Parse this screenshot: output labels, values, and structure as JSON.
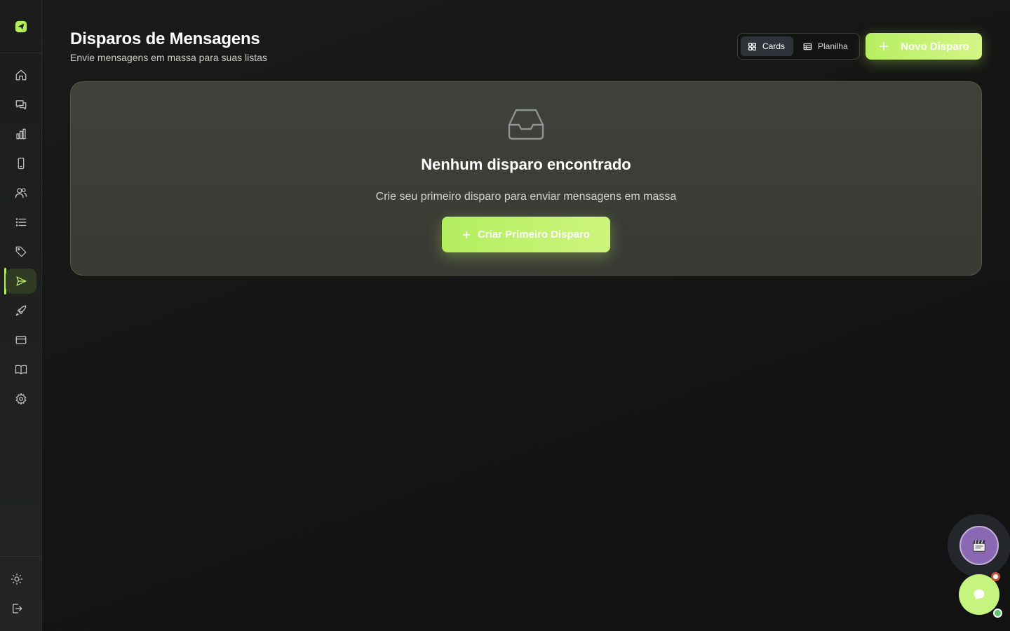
{
  "header": {
    "title": "Disparos de Mensagens",
    "subtitle": "Envie mensagens em massa para suas listas"
  },
  "view_toggle": {
    "cards_label": "Cards",
    "sheet_label": "Planilha",
    "selected": "Cards"
  },
  "actions": {
    "new_label": "Novo Disparo"
  },
  "empty_state": {
    "title": "Nenhum disparo encontrado",
    "description": "Crie seu primeiro disparo para enviar mensagens em massa",
    "cta_label": "Criar Primeiro Disparo"
  },
  "sidebar": {
    "items": [
      {
        "icon": "home-icon",
        "active": false
      },
      {
        "icon": "chat-bubbles-icon",
        "active": false
      },
      {
        "icon": "bar-chart-icon",
        "active": false
      },
      {
        "icon": "smartphone-icon",
        "active": false
      },
      {
        "icon": "users-icon",
        "active": false
      },
      {
        "icon": "list-icon",
        "active": false
      },
      {
        "icon": "tag-icon",
        "active": false
      },
      {
        "icon": "send-icon",
        "active": true
      },
      {
        "icon": "rocket-icon",
        "active": false
      },
      {
        "icon": "credit-card-icon",
        "active": false
      },
      {
        "icon": "book-icon",
        "active": false
      },
      {
        "icon": "gear-icon",
        "active": false
      }
    ],
    "bottom": [
      {
        "icon": "sun-icon"
      },
      {
        "icon": "logout-icon"
      }
    ]
  },
  "colors": {
    "accent": "#b7ec5a",
    "background": "#151615",
    "card": "#3c3f38",
    "video_button": "#8b68b3"
  }
}
